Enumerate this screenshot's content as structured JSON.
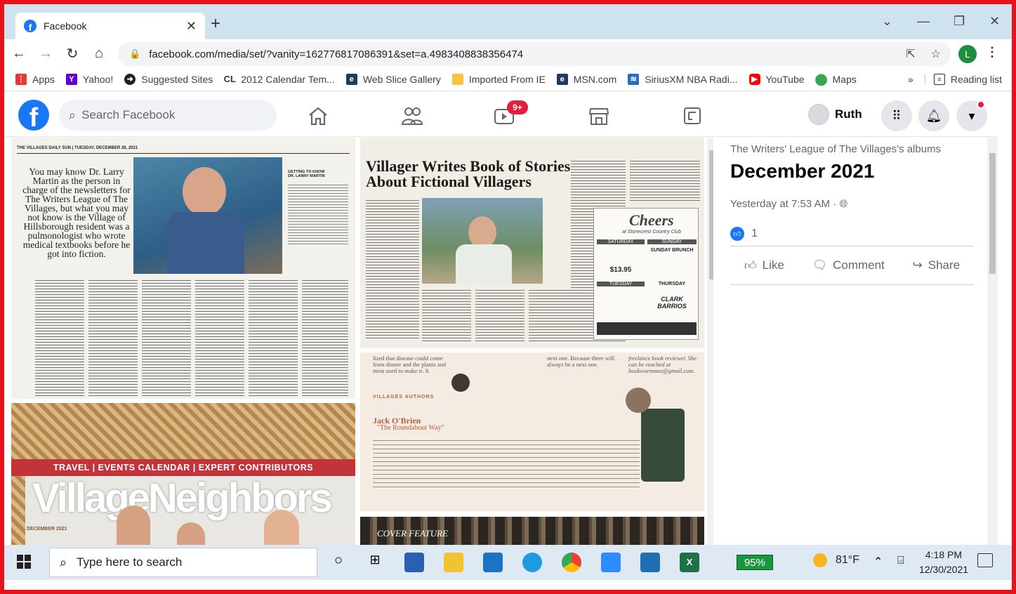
{
  "browser": {
    "tab_title": "Facebook",
    "url_host": "facebook.com",
    "url_path": "/media/set/?vanity=162776817086391&set=a.4983408838356474",
    "profile_initial": "L"
  },
  "bookmarks": [
    {
      "label": "Apps",
      "color": "#e53935"
    },
    {
      "label": "Yahoo!",
      "color": "#6001d2"
    },
    {
      "label": "Suggested Sites",
      "color": "#202124"
    },
    {
      "label": "2012 Calendar Tem...",
      "color": "#1e3a5f"
    },
    {
      "label": "Web Slice Gallery",
      "color": "#1e3a5f"
    },
    {
      "label": "Imported From IE",
      "color": "#f6c343"
    },
    {
      "label": "MSN.com",
      "color": "#1e3a5f"
    },
    {
      "label": "SiriusXM NBA Radi...",
      "color": "#2a6ebb"
    },
    {
      "label": "YouTube",
      "color": "#ff0000"
    },
    {
      "label": "Maps",
      "color": "#34a853"
    }
  ],
  "bookmarks_more": "»",
  "reading_list": "Reading list",
  "facebook": {
    "search_placeholder": "Search Facebook",
    "notif_badge": "9+",
    "user_name": "Ruth"
  },
  "album": {
    "owner_link": "The Writers' League of The Villages's albums",
    "title": "December 2021",
    "posted": "Yesterday at 7:53 AM · ",
    "like_count": "1",
    "actions": {
      "like": "Like",
      "comment": "Comment",
      "share": "Share"
    }
  },
  "clippings": {
    "c1_header": "THE VILLAGES DAILY SUN",
    "c1_date": "TUESDAY, DECEMBER 28, 2021",
    "c1_quote": "You may know Dr. Larry Martin as the person in charge of the newsletters for The Writers League of The Villages, but what you may not know is the Village of Hillsborough resident was a pulmonologist who wrote medical textbooks before he got into fiction.",
    "c1_sidebar_title": "GETTING TO KNOW",
    "c1_sidebar_sub": "DR. LARRY MARTIN",
    "c2_headline": "Villager Writes Book of Stories About Fictional Villagers",
    "c2_ad_title": "Cheers",
    "c2_ad_sub": "at Stonecrest Country Club",
    "c2_sat": "SATURDAY",
    "c2_sun": "SUNDAY",
    "c2_sun_brunch": "SUNDAY BRUNCH",
    "c2_tue": "TUESDAY",
    "c2_thu": "THURSDAY",
    "c2_price": "$13.95",
    "c2_clark": "CLARK BARRIOS",
    "c3_section": "VILLAGES AUTHORS",
    "c3_author": "Jack O'Brien",
    "c3_book": "\"The Roundabout Way\"",
    "c3_top_left": "lized that disease could come from dinner and the plants and meat used to make it. It",
    "c3_top_mid": "next one. Because there will always be a next one.",
    "c3_top_right": "freelance book reviewer. She can be reached at bookwormmez@gmail.com.",
    "c4_nav": "TRAVEL | EVENTS CALENDAR | EXPERT CONTRIBUTORS",
    "c4_brand": "VillageNeighbors",
    "c4_date": "DECEMBER 2021",
    "c5_label": "COVER FEATURE"
  },
  "taskbar": {
    "search_placeholder": "Type here to search",
    "battery": "95%",
    "temp": "81°F",
    "time": "4:18 PM",
    "date": "12/30/2021"
  }
}
